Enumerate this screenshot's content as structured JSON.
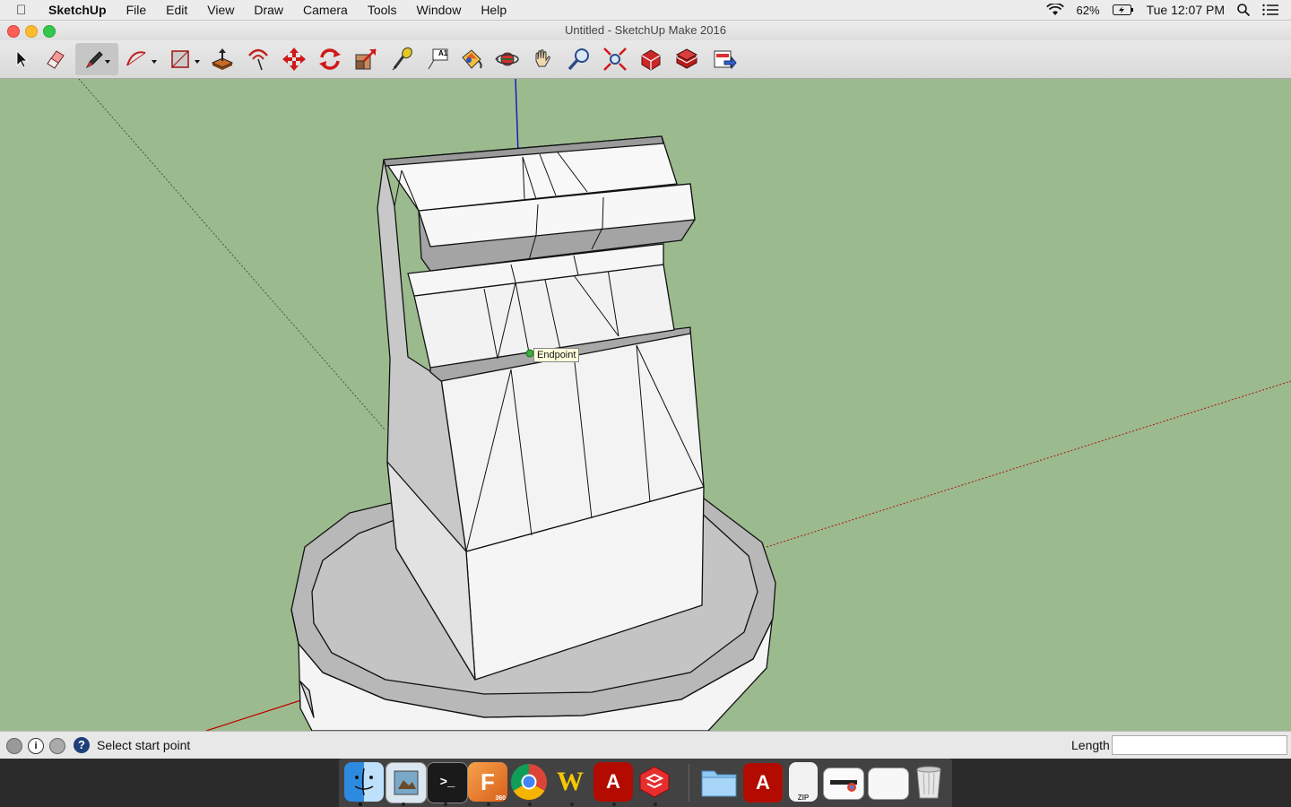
{
  "menubar": {
    "app": "SketchUp",
    "items": [
      "File",
      "Edit",
      "View",
      "Draw",
      "Camera",
      "Tools",
      "Window",
      "Help"
    ],
    "battery": "62%",
    "clock": "Tue 12:07 PM"
  },
  "window": {
    "title": "Untitled - SketchUp Make 2016"
  },
  "toolbar": {
    "tools": [
      "select-tool",
      "eraser-tool",
      "line-tool",
      "arc-tool",
      "rectangle-tool",
      "push-pull-tool",
      "offset-tool",
      "move-tool",
      "rotate-tool",
      "scale-tool",
      "tape-measure-tool",
      "text-tool",
      "paint-bucket-tool",
      "orbit-tool",
      "pan-tool",
      "zoom-tool",
      "zoom-extents-tool",
      "warehouse-tool",
      "extension-warehouse-tool",
      "layout-tool"
    ],
    "text_tool_label": "A1"
  },
  "viewport": {
    "inference_tooltip": "Endpoint"
  },
  "status": {
    "message": "Select start point",
    "measurement_label": "Length",
    "measurement_value": ""
  },
  "dock": {
    "apps": [
      "finder",
      "preview",
      "terminal",
      "fusion-360",
      "chrome",
      "wunderlist",
      "acrobat",
      "sketchup",
      "folder",
      "acrobat-doc",
      "zip-file",
      "chrome-window",
      "app-window",
      "trash"
    ],
    "fusion_badge": "360"
  },
  "colors": {
    "ground": "#9bbb8f",
    "face_light": "#f4f4f4",
    "face_dark": "#b4b4b4",
    "red_axis": "#c00000",
    "blue_axis": "#0000c0",
    "green_axis": "#006a00"
  }
}
